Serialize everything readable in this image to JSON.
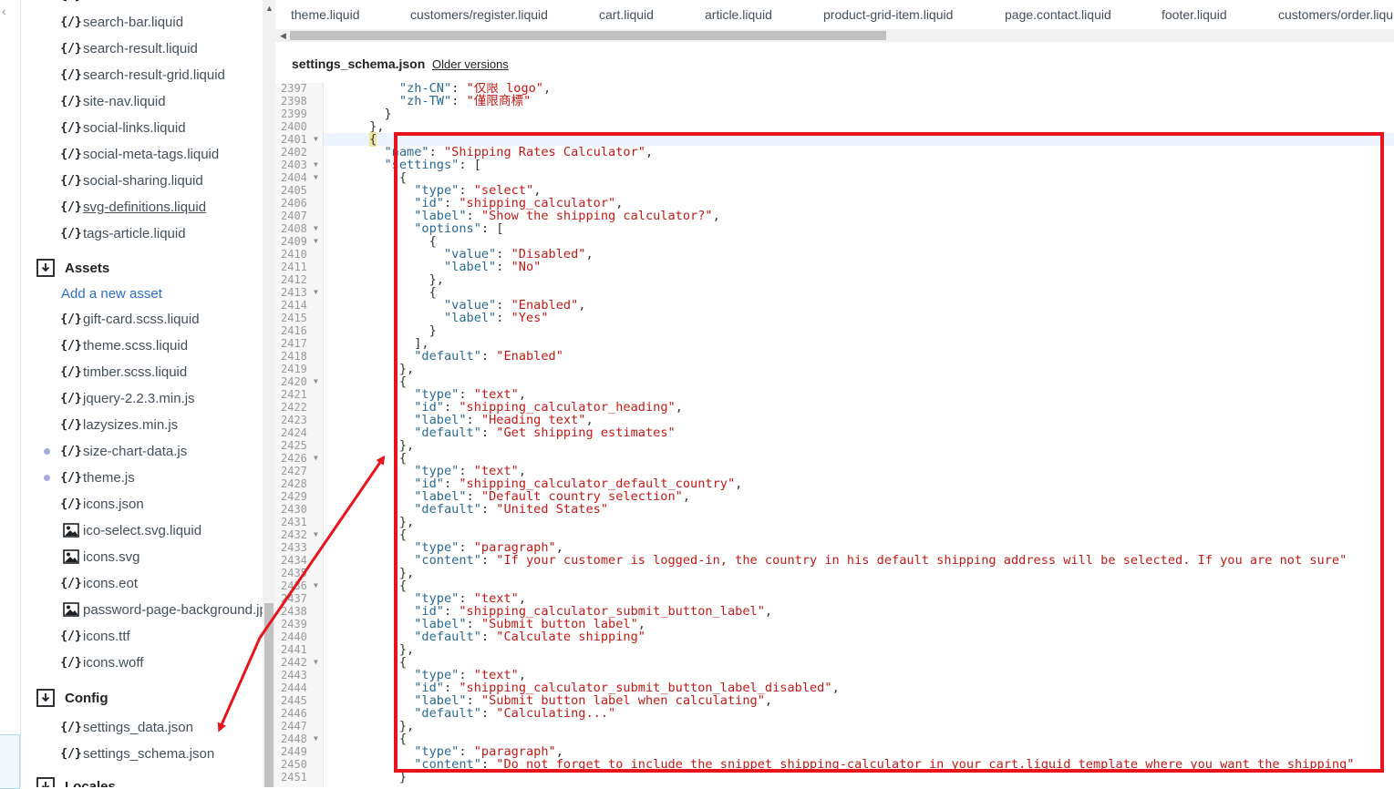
{
  "sidebar": {
    "top_files": [
      {
        "name": "search-bar.liquid",
        "icon": "liquid-file-icon"
      },
      {
        "name": "search-result.liquid",
        "icon": "liquid-file-icon"
      },
      {
        "name": "search-result-grid.liquid",
        "icon": "liquid-file-icon"
      },
      {
        "name": "site-nav.liquid",
        "icon": "liquid-file-icon"
      },
      {
        "name": "social-links.liquid",
        "icon": "liquid-file-icon"
      },
      {
        "name": "social-meta-tags.liquid",
        "icon": "liquid-file-icon"
      },
      {
        "name": "social-sharing.liquid",
        "icon": "liquid-file-icon"
      },
      {
        "name": "svg-definitions.liquid",
        "icon": "liquid-file-icon",
        "underline": true
      },
      {
        "name": "tags-article.liquid",
        "icon": "liquid-file-icon"
      }
    ],
    "assets": {
      "title": "Assets",
      "add_label": "Add a new asset",
      "files": [
        {
          "name": "gift-card.scss.liquid",
          "icon": "liquid-file-icon"
        },
        {
          "name": "theme.scss.liquid",
          "icon": "liquid-file-icon"
        },
        {
          "name": "timber.scss.liquid",
          "icon": "liquid-file-icon"
        },
        {
          "name": "jquery-2.2.3.min.js",
          "icon": "liquid-file-icon"
        },
        {
          "name": "lazysizes.min.js",
          "icon": "liquid-file-icon"
        },
        {
          "name": "size-chart-data.js",
          "icon": "liquid-file-icon",
          "modified": true
        },
        {
          "name": "theme.js",
          "icon": "liquid-file-icon",
          "modified": true
        },
        {
          "name": "icons.json",
          "icon": "liquid-file-icon"
        },
        {
          "name": "ico-select.svg.liquid",
          "icon": "image-file-icon"
        },
        {
          "name": "icons.svg",
          "icon": "image-file-icon"
        },
        {
          "name": "icons.eot",
          "icon": "liquid-file-icon"
        },
        {
          "name": "password-page-background.jpg",
          "icon": "image-file-icon"
        },
        {
          "name": "icons.ttf",
          "icon": "liquid-file-icon"
        },
        {
          "name": "icons.woff",
          "icon": "liquid-file-icon"
        }
      ]
    },
    "config": {
      "title": "Config",
      "files": [
        {
          "name": "settings_data.json",
          "icon": "liquid-file-icon"
        },
        {
          "name": "settings_schema.json",
          "icon": "liquid-file-icon"
        }
      ]
    },
    "locales": {
      "title": "Locales"
    }
  },
  "tabs": [
    "theme.liquid",
    "customers/register.liquid",
    "cart.liquid",
    "article.liquid",
    "product-grid-item.liquid",
    "page.contact.liquid",
    "footer.liquid",
    "customers/order.liquid"
  ],
  "editor": {
    "file_name": "settings_schema.json",
    "older_versions_label": "Older versions",
    "lines": [
      {
        "n": "2397",
        "fold": false,
        "text": "          \"zh-CN\": \"仅限 logo\","
      },
      {
        "n": "2398",
        "fold": false,
        "text": "          \"zh-TW\": \"僅限商標\""
      },
      {
        "n": "2399",
        "fold": false,
        "text": "        }"
      },
      {
        "n": "2400",
        "fold": false,
        "text": "      },"
      },
      {
        "n": "2401",
        "fold": true,
        "text": "      {"
      },
      {
        "n": "2402",
        "fold": false,
        "text": "        \"name\": \"Shipping Rates Calculator\","
      },
      {
        "n": "2403",
        "fold": true,
        "text": "        \"settings\": ["
      },
      {
        "n": "2404",
        "fold": true,
        "text": "          {"
      },
      {
        "n": "2405",
        "fold": false,
        "text": "            \"type\": \"select\","
      },
      {
        "n": "2406",
        "fold": false,
        "text": "            \"id\": \"shipping_calculator\","
      },
      {
        "n": "2407",
        "fold": false,
        "text": "            \"label\": \"Show the shipping calculator?\","
      },
      {
        "n": "2408",
        "fold": true,
        "text": "            \"options\": ["
      },
      {
        "n": "2409",
        "fold": true,
        "text": "              {"
      },
      {
        "n": "2410",
        "fold": false,
        "text": "                \"value\": \"Disabled\","
      },
      {
        "n": "2411",
        "fold": false,
        "text": "                \"label\": \"No\""
      },
      {
        "n": "2412",
        "fold": false,
        "text": "              },"
      },
      {
        "n": "2413",
        "fold": true,
        "text": "              {"
      },
      {
        "n": "2414",
        "fold": false,
        "text": "                \"value\": \"Enabled\","
      },
      {
        "n": "2415",
        "fold": false,
        "text": "                \"label\": \"Yes\""
      },
      {
        "n": "2416",
        "fold": false,
        "text": "              }"
      },
      {
        "n": "2417",
        "fold": false,
        "text": "            ],"
      },
      {
        "n": "2418",
        "fold": false,
        "text": "            \"default\": \"Enabled\""
      },
      {
        "n": "2419",
        "fold": false,
        "text": "          },"
      },
      {
        "n": "2420",
        "fold": true,
        "text": "          {"
      },
      {
        "n": "2421",
        "fold": false,
        "text": "            \"type\": \"text\","
      },
      {
        "n": "2422",
        "fold": false,
        "text": "            \"id\": \"shipping_calculator_heading\","
      },
      {
        "n": "2423",
        "fold": false,
        "text": "            \"label\": \"Heading text\","
      },
      {
        "n": "2424",
        "fold": false,
        "text": "            \"default\": \"Get shipping estimates\""
      },
      {
        "n": "2425",
        "fold": false,
        "text": "          },"
      },
      {
        "n": "2426",
        "fold": true,
        "text": "          {"
      },
      {
        "n": "2427",
        "fold": false,
        "text": "            \"type\": \"text\","
      },
      {
        "n": "2428",
        "fold": false,
        "text": "            \"id\": \"shipping_calculator_default_country\","
      },
      {
        "n": "2429",
        "fold": false,
        "text": "            \"label\": \"Default country selection\","
      },
      {
        "n": "2430",
        "fold": false,
        "text": "            \"default\": \"United States\""
      },
      {
        "n": "2431",
        "fold": false,
        "text": "          },"
      },
      {
        "n": "2432",
        "fold": true,
        "text": "          {"
      },
      {
        "n": "2433",
        "fold": false,
        "text": "            \"type\": \"paragraph\","
      },
      {
        "n": "2434",
        "fold": false,
        "text": "            \"content\": \"If your customer is logged-in, the country in his default shipping address will be selected. If you are not sure\""
      },
      {
        "n": "2435",
        "fold": false,
        "text": "          },"
      },
      {
        "n": "2436",
        "fold": true,
        "text": "          {"
      },
      {
        "n": "2437",
        "fold": false,
        "text": "            \"type\": \"text\","
      },
      {
        "n": "2438",
        "fold": false,
        "text": "            \"id\": \"shipping_calculator_submit_button_label\","
      },
      {
        "n": "2439",
        "fold": false,
        "text": "            \"label\": \"Submit button label\","
      },
      {
        "n": "2440",
        "fold": false,
        "text": "            \"default\": \"Calculate shipping\""
      },
      {
        "n": "2441",
        "fold": false,
        "text": "          },"
      },
      {
        "n": "2442",
        "fold": true,
        "text": "          {"
      },
      {
        "n": "2443",
        "fold": false,
        "text": "            \"type\": \"text\","
      },
      {
        "n": "2444",
        "fold": false,
        "text": "            \"id\": \"shipping_calculator_submit_button_label_disabled\","
      },
      {
        "n": "2445",
        "fold": false,
        "text": "            \"label\": \"Submit button label when calculating\","
      },
      {
        "n": "2446",
        "fold": false,
        "text": "            \"default\": \"Calculating...\""
      },
      {
        "n": "2447",
        "fold": false,
        "text": "          },"
      },
      {
        "n": "2448",
        "fold": true,
        "text": "          {"
      },
      {
        "n": "2449",
        "fold": false,
        "text": "            \"type\": \"paragraph\","
      },
      {
        "n": "2450",
        "fold": false,
        "text": "            \"content\": \"Do not forget to include the snippet shipping-calculator in your cart.liquid template where you want the shipping\""
      },
      {
        "n": "2451",
        "fold": false,
        "text": "          }"
      }
    ]
  },
  "colors": {
    "annotation_red": "#e8141c",
    "json_key": "#2a6a95",
    "json_string": "#c41a16",
    "link": "#2c6ecb",
    "modified_dot": "#a5acdc"
  }
}
